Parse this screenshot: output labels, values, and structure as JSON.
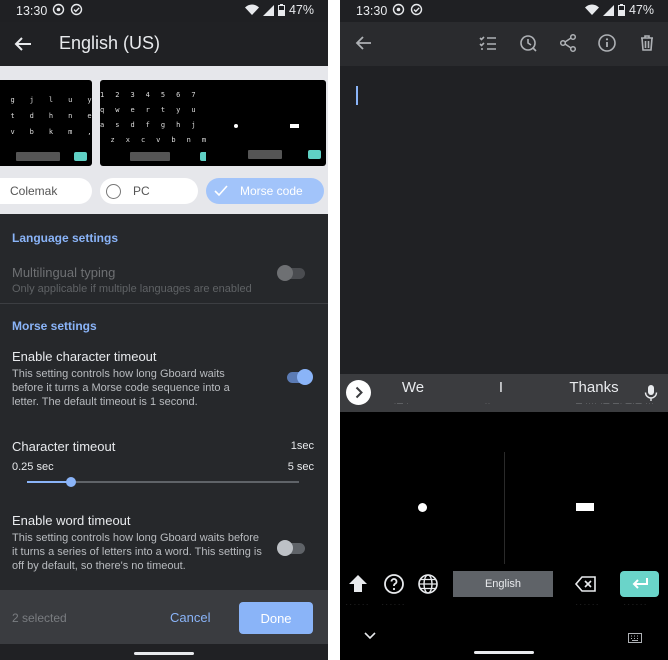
{
  "status_bar": {
    "time": "13:30",
    "battery": "47%"
  },
  "left": {
    "title": "English (US)",
    "layout_options": [
      {
        "label": "Colemak",
        "selected": false
      },
      {
        "label": "PC",
        "selected": false
      },
      {
        "label": "Morse code",
        "selected": true
      }
    ],
    "previews": {
      "colemak_rows": [
        "f p g j l u y ;",
        "r s t d h n e i o",
        "x c v b k m ,"
      ],
      "pc_rows": [
        "1 2 3 4 5 6 7 8 9 0",
        "q w e r t y u i o p",
        "a s d f g h j k l",
        "z x c v b n m"
      ]
    },
    "language_section": {
      "header": "Language settings",
      "multilingual_title": "Multilingual typing",
      "multilingual_summary": "Only applicable if multiple languages are enabled",
      "multilingual_enabled": false
    },
    "morse_section": {
      "header": "Morse settings",
      "char_timeout_title": "Enable character timeout",
      "char_timeout_summary": "This setting controls how long Gboard waits before it turns a Morse code sequence into a letter. The default timeout is 1 second.",
      "char_timeout_enabled": true,
      "slider_title": "Character timeout",
      "slider_value": "1sec",
      "slider_min": "0.25 sec",
      "slider_max": "5 sec",
      "slider_fraction": 0.16,
      "word_timeout_title": "Enable word timeout",
      "word_timeout_summary": "This setting controls how long Gboard waits before it turns a series of letters into a word. This setting is off by default, so there's no timeout.",
      "word_timeout_enabled": false
    },
    "bottom_bar": {
      "selected_count": "2 selected",
      "cancel": "Cancel",
      "done": "Done"
    }
  },
  "right": {
    "suggestions": [
      "We",
      "I",
      "Thanks"
    ],
    "suggestion_morse": [
      "·— ·",
      "··",
      "— ···· ·— —· —·— ···"
    ],
    "space_label": "English",
    "colors": {
      "enter": "#6ad4c9",
      "accent": "#8ab4f8"
    }
  }
}
